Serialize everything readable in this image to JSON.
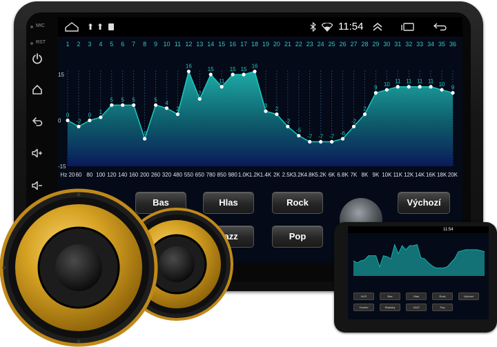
{
  "status_bar": {
    "clock": "11:54",
    "icons": [
      "home-outline-icon",
      "notification-icon",
      "notification-icon",
      "notification-icon",
      "bluetooth-icon",
      "wifi-icon",
      "expand-up-icon",
      "recent-apps-icon",
      "back-icon"
    ]
  },
  "side_panel": {
    "mic_label": "MIC",
    "rst_label": "RST",
    "buttons": [
      "power-icon",
      "home-icon",
      "back-icon",
      "volume-up-icon",
      "volume-down-icon"
    ]
  },
  "equalizer": {
    "band_numbers": [
      "1",
      "2",
      "3",
      "4",
      "5",
      "6",
      "7",
      "8",
      "9",
      "10",
      "11",
      "12",
      "13",
      "14",
      "15",
      "16",
      "17",
      "18",
      "19",
      "20",
      "21",
      "22",
      "23",
      "24",
      "25",
      "26",
      "27",
      "28",
      "29",
      "30",
      "31",
      "32",
      "33",
      "34",
      "35",
      "36"
    ],
    "frequency_labels": [
      "Hz 20",
      "60",
      "80",
      "100",
      "120",
      "140",
      "160",
      "200",
      "260",
      "320",
      "480",
      "550",
      "650",
      "780",
      "850",
      "980",
      "1.0K",
      "1.2K",
      "1.4K",
      "2K",
      "2.5K",
      "3.2K",
      "4.8K",
      "5.2K",
      "6K",
      "6.8K",
      "7K",
      "8K",
      "9K",
      "10K",
      "11K",
      "12K",
      "14K",
      "16K",
      "18K",
      "20K"
    ],
    "y_max_label": "15",
    "y_zero_label": "0",
    "y_min_label": "-15",
    "ylim": [
      -15,
      15
    ],
    "values": [
      0,
      -2,
      0,
      1,
      5,
      5,
      5,
      -6,
      5,
      4,
      2,
      16,
      7,
      15,
      11,
      15,
      15,
      16,
      3,
      2,
      -2,
      -5,
      -7,
      -7,
      -7,
      -6,
      -2,
      2,
      9,
      10,
      11,
      11,
      11,
      11,
      10,
      9
    ],
    "accent_color": "#1bc9bf"
  },
  "presets": {
    "bas": "Bas",
    "hlas": "Hlas",
    "rock": "Rock",
    "vychozi": "Výchozí",
    "jazz": "Jazz",
    "pop": "Pop"
  },
  "thumbnail": {
    "clock": "11:54",
    "row1": [
      "Hi-Fi",
      "Bas",
      "Hlas",
      "Rock",
      "Výchozí"
    ],
    "row2": [
      "Osobní",
      "Klasický",
      "JAZZ",
      "Pop"
    ]
  },
  "colors": {
    "gold": "#c9961c",
    "screen_bg": "#050a18"
  }
}
